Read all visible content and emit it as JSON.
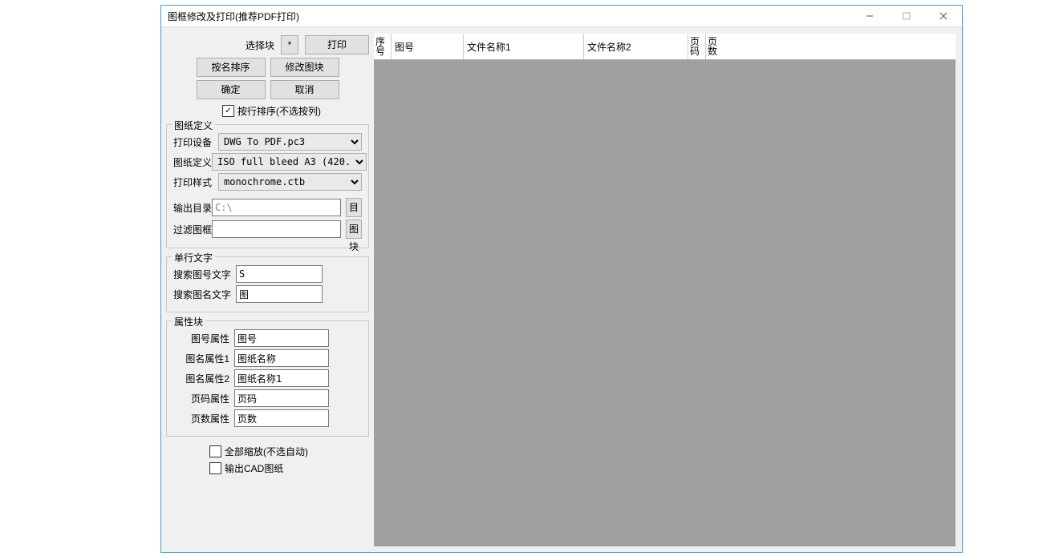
{
  "window": {
    "title": "图框修改及打印(推荐PDF打印)"
  },
  "topbar": {
    "select_label": "选择块",
    "star_btn": "*",
    "print_btn": "打印",
    "sort_name_btn": "按名排序",
    "modify_block_btn": "修改图块",
    "ok_btn": "确定",
    "cancel_btn": "取消",
    "row_sort_label": "按行排序(不选按列)"
  },
  "sheet_def": {
    "legend": "图纸定义",
    "printer_label": "打印设备",
    "printer_value": "DWG To PDF.pc3",
    "paper_label": "图纸定义",
    "paper_value": "ISO full bleed A3 (420.",
    "style_label": "打印样式",
    "style_value": "monochrome.ctb",
    "outdir_label": "输出目录",
    "outdir_value": "C:\\",
    "outdir_btn": "目录",
    "filter_label": "过滤图框",
    "filter_value": "",
    "filter_btn": "图块"
  },
  "single_text": {
    "legend": "单行文字",
    "search_num_label": "搜索图号文字",
    "search_num_value": "S",
    "search_name_label": "搜索图名文字",
    "search_name_value": "图"
  },
  "attr_block": {
    "legend": "属性块",
    "num_attr_label": "图号属性",
    "num_attr_value": "图号",
    "name1_attr_label": "图名属性1",
    "name1_attr_value": "图纸名称",
    "name2_attr_label": "图名属性2",
    "name2_attr_value": "图纸名称1",
    "page_attr_label": "页码属性",
    "page_attr_value": "页码",
    "pages_attr_label": "页数属性",
    "pages_attr_value": "页数"
  },
  "options": {
    "scale_all_label": "全部缩放(不选自动)",
    "output_cad_label": "输出CAD图纸"
  },
  "grid": {
    "col_index": "序号",
    "col_number": "图号",
    "col_name1": "文件名称1",
    "col_name2": "文件名称2",
    "col_page": "页码",
    "col_pages": "页数"
  }
}
